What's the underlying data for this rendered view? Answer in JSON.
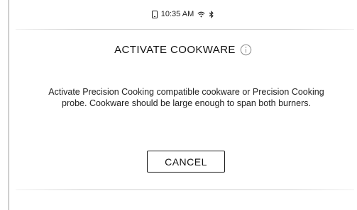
{
  "status_bar": {
    "time": "10:35 AM",
    "icons": [
      "phone-icon",
      "wifi-icon",
      "bluetooth-icon"
    ]
  },
  "dialog": {
    "title": "ACTIVATE COOKWARE",
    "title_icon": "info-icon",
    "message": "Activate Precision Cooking compatible cookware or Precision Cooking probe.  Cookware should be large enough to span both burners.",
    "cancel_label": "CANCEL"
  }
}
